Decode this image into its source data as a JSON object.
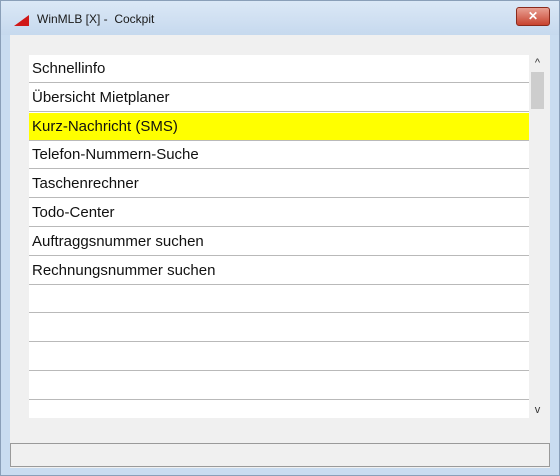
{
  "window": {
    "title": "WinMLB [X] -  Cockpit",
    "close_label": "✕"
  },
  "list": {
    "items": [
      "Schnellinfo",
      "Übersicht Mietplaner",
      "Kurz-Nachricht (SMS)",
      "Telefon-Nummern-Suche",
      "Taschenrechner",
      "Todo-Center",
      "Auftraggsnummer suchen",
      "Rechnungsnummer suchen",
      "",
      "",
      "",
      "",
      ""
    ],
    "selected_index": 2,
    "highlight_color": "#ffff00"
  },
  "scrollbar": {
    "up_glyph": "^",
    "down_glyph": "v"
  },
  "status": {
    "text": ""
  }
}
